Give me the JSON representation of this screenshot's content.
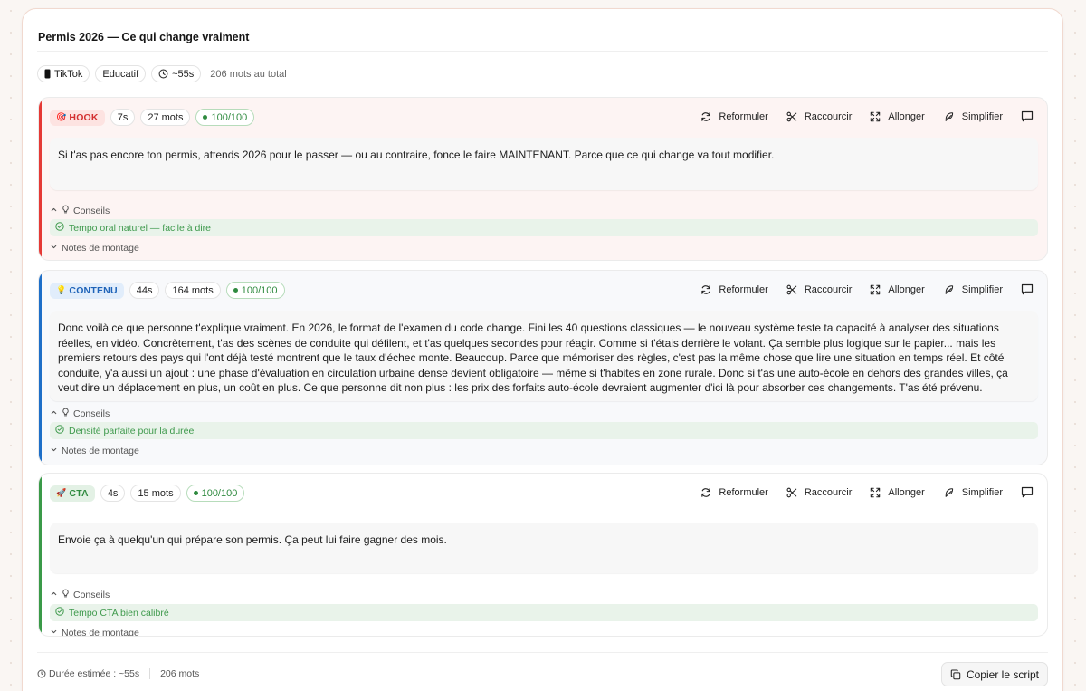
{
  "title": "Permis 2026 — Ce qui change vraiment",
  "meta": {
    "platform": "TikTok",
    "category": "Educatif",
    "duration": "~55s",
    "total_words": "206 mots au total"
  },
  "actions": {
    "rephrase": "Reformuler",
    "shorten": "Raccourcir",
    "lengthen": "Allonger",
    "simplify": "Simplifier"
  },
  "labels": {
    "tips": "Conseils",
    "edit_notes": "Notes de montage"
  },
  "sections": [
    {
      "emoji": "🎯",
      "tag": "HOOK",
      "duration": "7s",
      "words": "27 mots",
      "score": "100/100",
      "text": "Si t'as pas encore ton permis, attends 2026 pour le passer — ou au contraire, fonce le faire MAINTENANT. Parce que ce qui change va tout modifier.",
      "tip": "Tempo oral naturel — facile à dire",
      "color": "#e53935"
    },
    {
      "emoji": "💡",
      "tag": "CONTENU",
      "duration": "44s",
      "words": "164 mots",
      "score": "100/100",
      "text": "Donc voilà ce que personne t'explique vraiment. En 2026, le format de l'examen du code change. Fini les 40 questions classiques — le nouveau système teste ta capacité à analyser des situations réelles, en vidéo. Concrètement, t'as des scènes de conduite qui défilent, et t'as quelques secondes pour réagir. Comme si t'étais derrière le volant. Ça semble plus logique sur le papier... mais les premiers retours des pays qui l'ont déjà testé montrent que le taux d'échec monte. Beaucoup. Parce que mémoriser des règles, c'est pas la même chose que lire une situation en temps réel. Et côté conduite, y'a aussi un ajout : une phase d'évaluation en circulation urbaine dense devient obligatoire — même si t'habites en zone rurale. Donc si t'as une auto-école en dehors des grandes villes, ça veut dire un déplacement en plus, un coût en plus. Ce que personne dit non plus : les prix des forfaits auto-école devraient augmenter d'ici là pour absorber ces changements. T'as été prévenu.",
      "tip": "Densité parfaite pour la durée",
      "color": "#1e6fc8"
    },
    {
      "emoji": "🚀",
      "tag": "CTA",
      "duration": "4s",
      "words": "15 mots",
      "score": "100/100",
      "text": "Envoie ça à quelqu'un qui prépare son permis. Ça peut lui faire gagner des mois.",
      "tip": "Tempo CTA bien calibré",
      "color": "#3a9a48"
    }
  ],
  "footer": {
    "duration": "Durée estimée : ~55s",
    "words": "206 mots",
    "copy_label": "Copier le script"
  },
  "colors": {
    "hook_bg": "#fdf4f3",
    "hook_tag_bg": "#fde3e1",
    "hook_tag_fg": "#d32f2f",
    "content_bg": "#f8f9fb",
    "content_tag_bg": "#e1edfb",
    "content_tag_fg": "#1e63b8",
    "cta_bg": "#ffffff",
    "cta_tag_bg": "#e3f1e5",
    "cta_tag_fg": "#2f8a3f",
    "tip_fg": "#3f9a4d"
  },
  "icons": {
    "platform": "phone-icon",
    "duration": "clock-icon",
    "rephrase": "refresh-icon",
    "shorten": "scissors-icon",
    "lengthen": "expand-icon",
    "simplify": "feather-icon",
    "comment": "comment-icon",
    "tips": "lightbulb-icon",
    "tip_check": "check-circle-icon",
    "copy": "copy-icon"
  }
}
